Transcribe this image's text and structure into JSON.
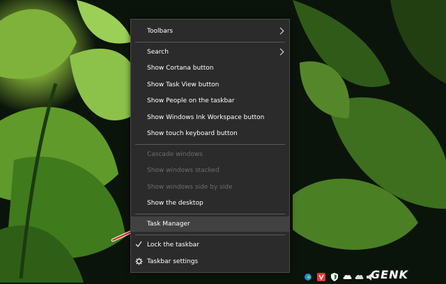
{
  "context_menu": {
    "items": [
      {
        "label": "Toolbars",
        "submenu": true,
        "disabled": false
      },
      {
        "label": "Search",
        "submenu": true,
        "disabled": false
      },
      {
        "label": "Show Cortana button",
        "disabled": false
      },
      {
        "label": "Show Task View button",
        "disabled": false
      },
      {
        "label": "Show People on the taskbar",
        "disabled": false
      },
      {
        "label": "Show Windows Ink Workspace button",
        "disabled": false
      },
      {
        "label": "Show touch keyboard button",
        "disabled": false
      },
      {
        "label": "Cascade windows",
        "disabled": true
      },
      {
        "label": "Show windows stacked",
        "disabled": true
      },
      {
        "label": "Show windows side by side",
        "disabled": true
      },
      {
        "label": "Show the desktop",
        "disabled": false
      },
      {
        "label": "Task Manager",
        "disabled": false,
        "highlighted": true
      },
      {
        "label": "Lock the taskbar",
        "checked": true,
        "disabled": false
      },
      {
        "label": "Taskbar settings",
        "icon": "gear-icon",
        "disabled": false
      }
    ]
  },
  "tray": {
    "icons": [
      "edge-icon",
      "vivaldi-icon",
      "security-icon",
      "onedrive-icon",
      "cloud-icon",
      "volume-icon"
    ]
  },
  "watermark": {
    "text": "GENK"
  },
  "colors": {
    "menu_bg": "#2b2b2b",
    "menu_text": "#ffffff",
    "menu_disabled": "#6d6d6d",
    "highlight": "#414141",
    "annotation_arrow": "#d81e1e"
  }
}
